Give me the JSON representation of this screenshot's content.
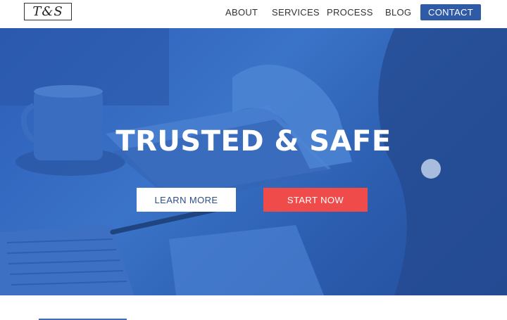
{
  "header": {
    "logo_text": "T&S",
    "nav": [
      {
        "label": "ABOUT"
      },
      {
        "label": "SERVICES"
      },
      {
        "label": "PROCESS"
      },
      {
        "label": "BLOG"
      }
    ],
    "contact_label": "CONTACT"
  },
  "hero": {
    "title": "TRUSTED & SAFE",
    "learn_more_label": "LEARN MORE",
    "start_now_label": "START NOW"
  },
  "colors": {
    "brand_blue": "#2f5aa6",
    "hero_blue": "#3a6dc0",
    "accent_red": "#ef4b4b",
    "text_dark": "#333333"
  }
}
